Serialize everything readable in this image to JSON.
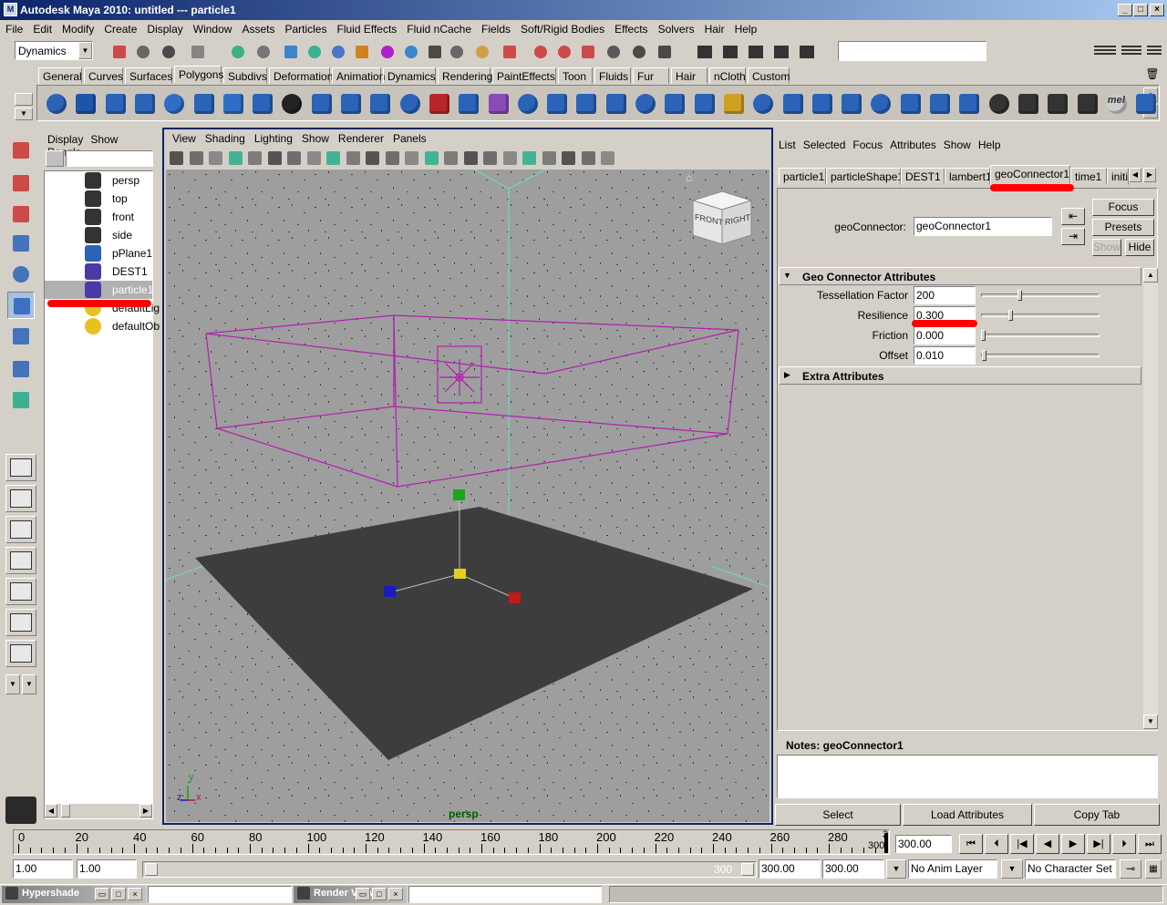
{
  "window": {
    "title": "Autodesk Maya 2010: untitled   ---   particle1"
  },
  "menubar": [
    "File",
    "Edit",
    "Modify",
    "Create",
    "Display",
    "Window",
    "Assets",
    "Particles",
    "Fluid Effects",
    "Fluid nCache",
    "Fields",
    "Soft/Rigid Bodies",
    "Effects",
    "Solvers",
    "Hair",
    "Help"
  ],
  "status_line": {
    "menu_set": "Dynamics",
    "input": ""
  },
  "shelf": {
    "tabs": [
      "General",
      "Curves",
      "Surfaces",
      "Polygons",
      "Subdivs",
      "Deformation",
      "Animation",
      "Dynamics",
      "Rendering",
      "PaintEffects",
      "Toon",
      "Fluids",
      "Fur",
      "Hair",
      "nCloth",
      "Custom"
    ],
    "active_tab": "Polygons",
    "mel_label": "mel"
  },
  "outliner": {
    "menu": [
      "Display",
      "Show",
      "Panels"
    ],
    "filter": "",
    "items": [
      {
        "label": "persp",
        "icon": "camera-icon"
      },
      {
        "label": "top",
        "icon": "camera-icon"
      },
      {
        "label": "front",
        "icon": "camera-icon"
      },
      {
        "label": "side",
        "icon": "camera-icon"
      },
      {
        "label": "pPlane1",
        "icon": "plane-icon"
      },
      {
        "label": "DEST1",
        "icon": "particle-icon"
      },
      {
        "label": "particle1",
        "icon": "particle-icon",
        "selected": true
      },
      {
        "label": "defaultLig",
        "icon": "light-icon"
      },
      {
        "label": "defaultOb",
        "icon": "light-icon"
      }
    ]
  },
  "viewport": {
    "menu": [
      "View",
      "Shading",
      "Lighting",
      "Show",
      "Renderer",
      "Panels"
    ],
    "camera_label": "persp",
    "viewcube": {
      "front": "FRONT",
      "right": "RIGHT"
    },
    "axis": {
      "x": "x",
      "y": "y",
      "z": "z"
    }
  },
  "attribute_editor": {
    "menu": [
      "List",
      "Selected",
      "Focus",
      "Attributes",
      "Show",
      "Help"
    ],
    "tabs": [
      "particle1",
      "particleShape1",
      "DEST1",
      "lambert1",
      "geoConnector1",
      "time1",
      "initi"
    ],
    "active_tab": "geoConnector1",
    "node_label": "geoConnector:",
    "node_name": "geoConnector1",
    "buttons": {
      "focus": "Focus",
      "presets": "Presets",
      "show": "Show",
      "hide": "Hide"
    },
    "section_title": "Geo Connector Attributes",
    "attributes": [
      {
        "label": "Tessellation Factor",
        "value": "200",
        "slider": 0.4
      },
      {
        "label": "Resilience",
        "value": "0.300",
        "slider": 0.3
      },
      {
        "label": "Friction",
        "value": "0.000",
        "slider": 0.0
      },
      {
        "label": "Offset",
        "value": "0.010",
        "slider": 0.01
      }
    ],
    "extra_section": "Extra Attributes",
    "notes_label": "Notes:  geoConnector1",
    "notes_text": "",
    "bottom_buttons": [
      "Select",
      "Load Attributes",
      "Copy Tab"
    ]
  },
  "time_slider": {
    "ticks": [
      "0",
      "20",
      "40",
      "60",
      "80",
      "100",
      "120",
      "140",
      "160",
      "180",
      "200",
      "220",
      "240",
      "260",
      "280"
    ],
    "current_frame_top": "3",
    "current_frame_bottom": "300",
    "current_time": "300.00"
  },
  "range_slider": {
    "start": "1.00",
    "start_inner": "1.00",
    "range_end_label": "300",
    "range_end": "300.00",
    "end": "300.00",
    "anim_layer": "No Anim Layer",
    "character_set": "No Character Set"
  },
  "taskbar": {
    "items": [
      "Hypershade",
      "Render View"
    ]
  }
}
